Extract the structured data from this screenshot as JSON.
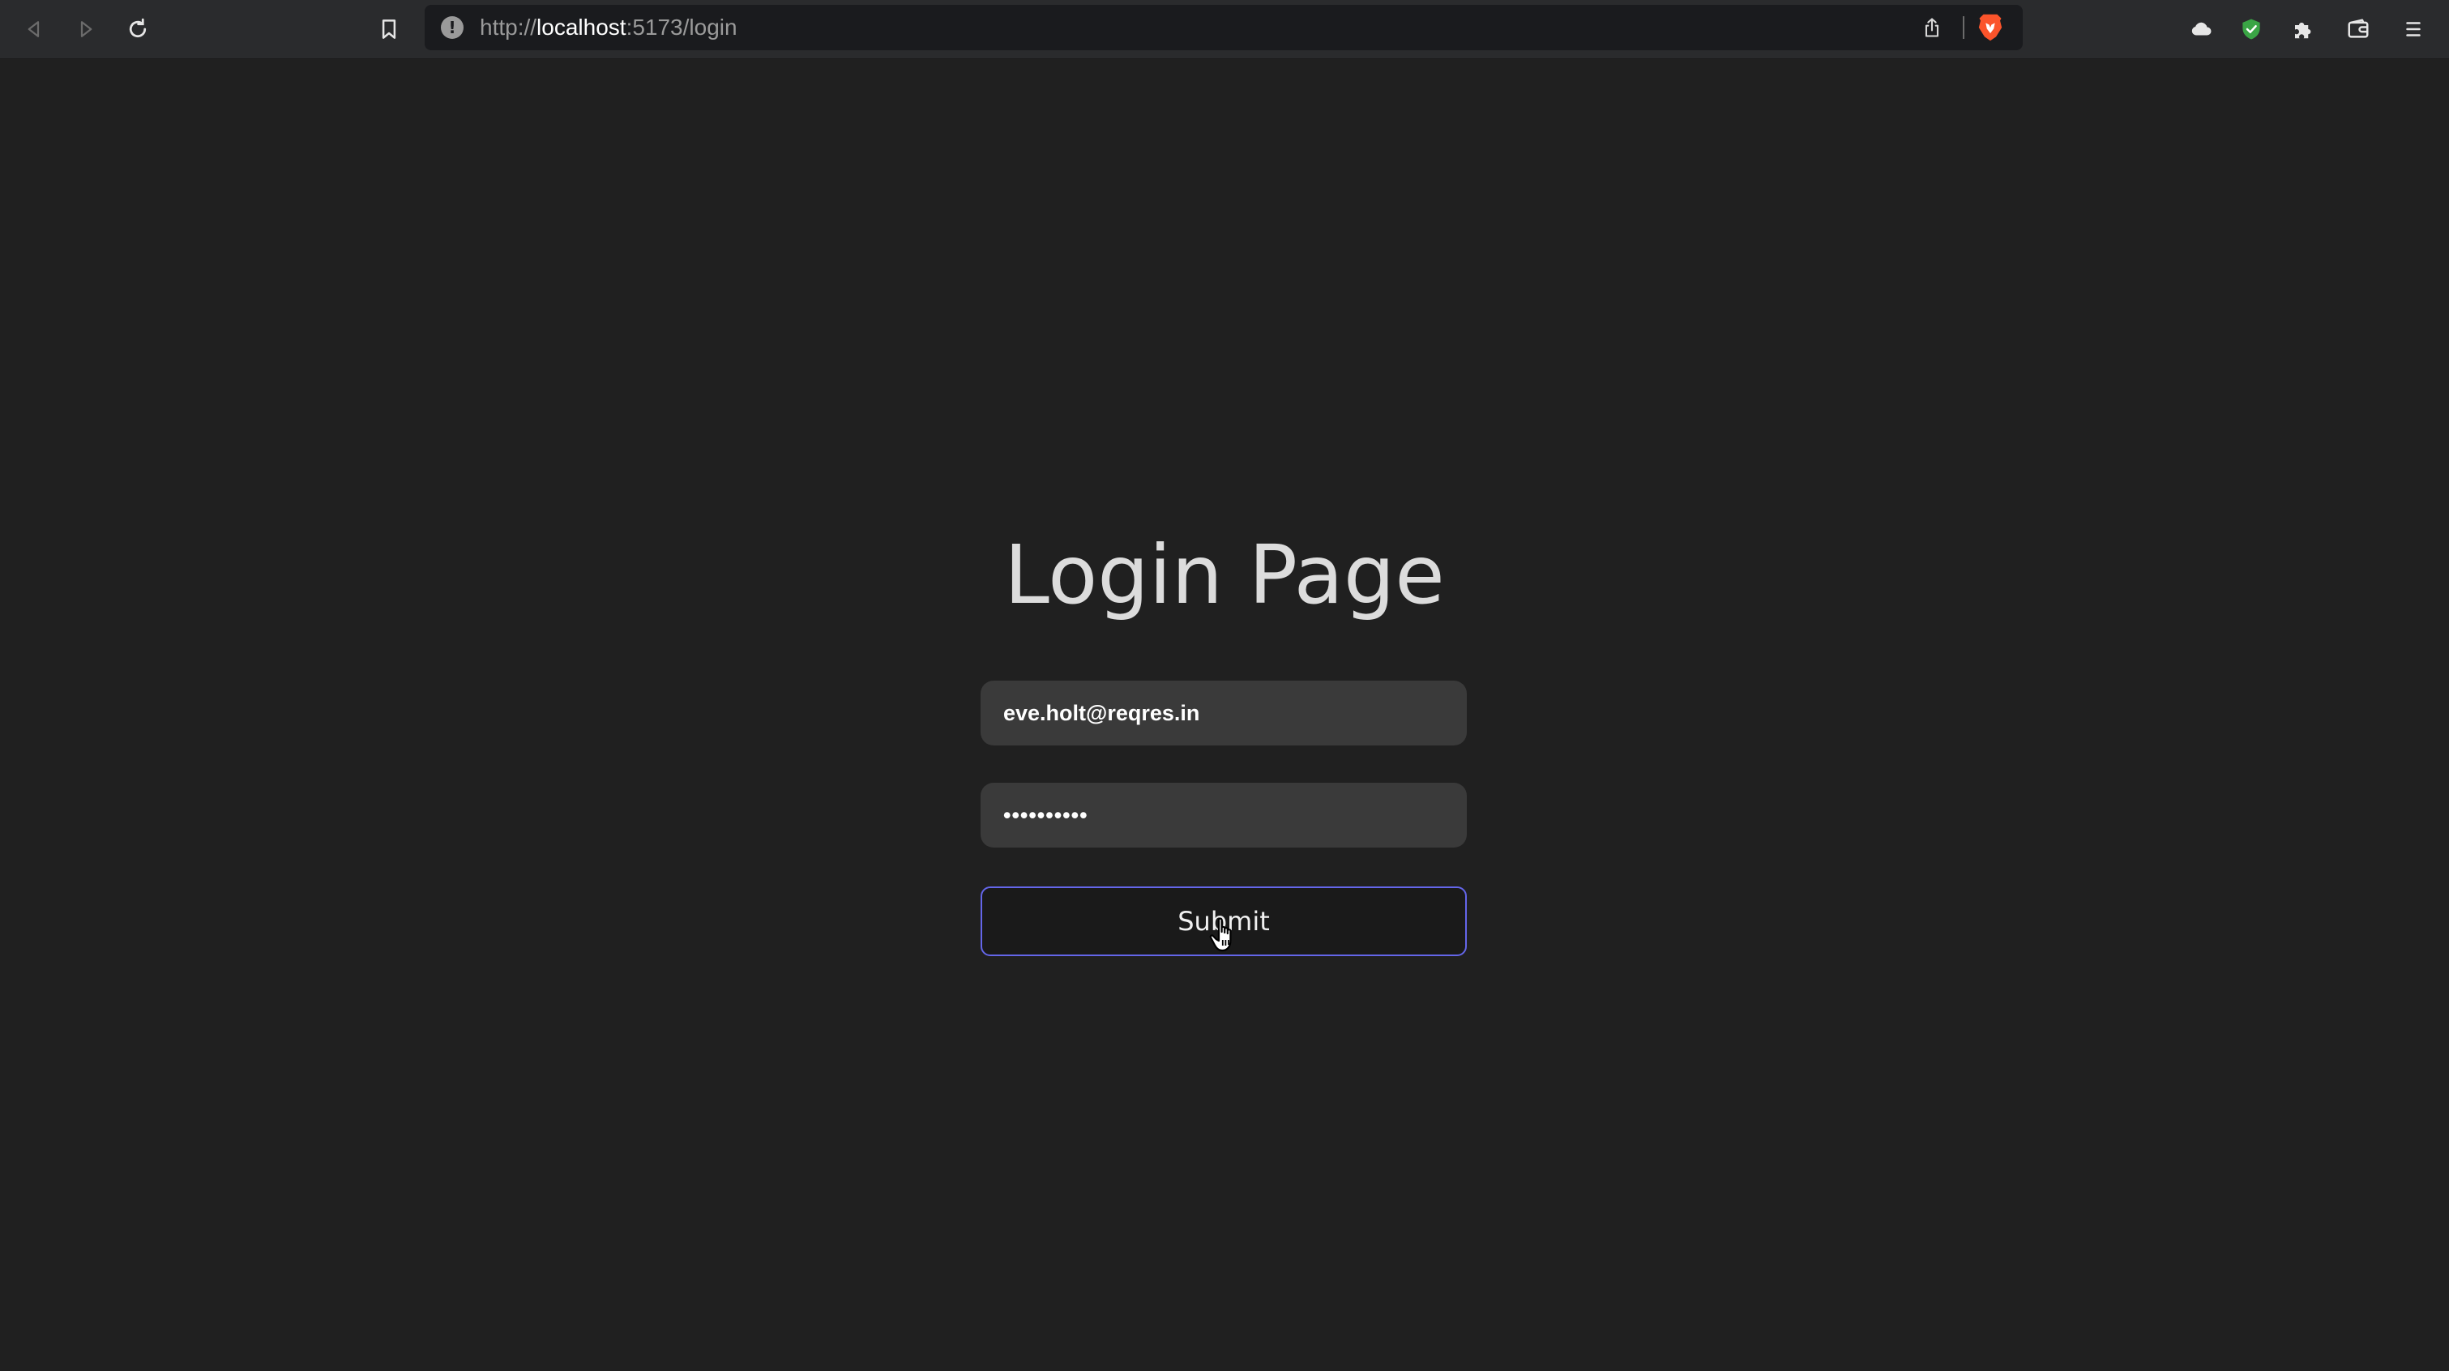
{
  "browser": {
    "url_scheme": "http://",
    "url_host": "localhost",
    "url_rest": ":5173/login",
    "buttons": {
      "back": "back-icon",
      "forward": "forward-icon",
      "reload": "reload-icon",
      "bookmark": "bookmark-icon",
      "share": "share-icon",
      "brave_shields": "brave-lion-icon",
      "cloud": "cloud-icon",
      "vpn_shield": "shield-check-icon",
      "extensions": "puzzle-icon",
      "wallet": "wallet-icon",
      "menu": "hamburger-menu-icon"
    },
    "colors": {
      "toolbar_bg": "#2a2b2d",
      "urlbar_bg": "#1a1b1e",
      "shield_green": "#3aa545",
      "brave_orange": "#fb542b"
    }
  },
  "page": {
    "background": "#202020",
    "title": "Login Page",
    "email": {
      "value": "eve.holt@reqres.in"
    },
    "password": {
      "value": "cityslicka"
    },
    "submit_label": "Submit",
    "accent_color": "#6466e9"
  }
}
